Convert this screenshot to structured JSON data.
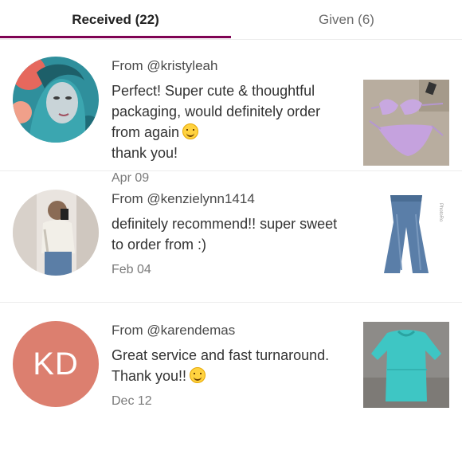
{
  "tabs": {
    "received_label": "Received (22)",
    "given_label": "Given (6)",
    "active": "received",
    "accent_color": "#7f0353"
  },
  "feedback": [
    {
      "from_label": "From @kristyleah",
      "comment": "Perfect! Super cute & thoughtful packaging, would definitely order from again",
      "comment_tail": "thank you!",
      "emoji": "smiling-face",
      "date": "Apr 09",
      "avatar_icon": "user-photo-avatar",
      "item_icon": "lavender-bikini-photo"
    },
    {
      "from_label": "From @kenzielynn1414",
      "comment": "definitely recommend!! super sweet to order from :)",
      "date": "Feb 04",
      "avatar_icon": "user-photo-avatar",
      "item_icon": "jeans-photo"
    },
    {
      "from_label": "From @karendemas",
      "comment": "Great service and fast turnaround. Thank you!!",
      "emoji": "smiling-face",
      "date": "Dec 12",
      "avatar_initials": "KD",
      "avatar_color": "#dc7f6f",
      "item_icon": "teal-top-photo"
    }
  ]
}
